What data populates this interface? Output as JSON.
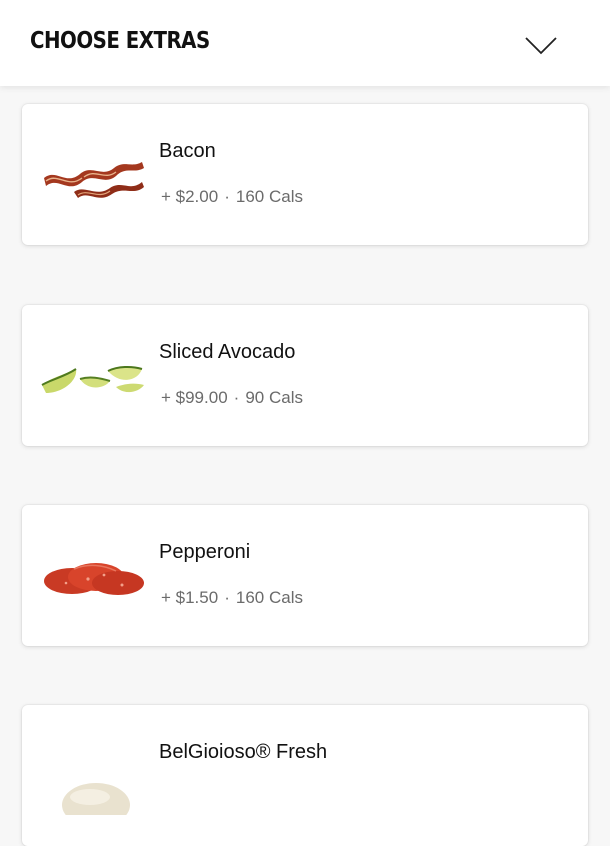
{
  "header": {
    "title": "CHOOSE EXTRAS",
    "collapse_icon": "chevron-down-icon"
  },
  "extras": [
    {
      "name": "Bacon",
      "price": "+ $2.00",
      "separator": "·",
      "calories": "160  Cals",
      "image": "bacon"
    },
    {
      "name": "Sliced Avocado",
      "price": "+ $99.00",
      "separator": "·",
      "calories": "90  Cals",
      "image": "avocado"
    },
    {
      "name": "Pepperoni",
      "price": "+ $1.50",
      "separator": "·",
      "calories": "160  Cals",
      "image": "pepperoni"
    },
    {
      "name": "BelGioioso® Fresh",
      "image": "mozzarella"
    }
  ]
}
